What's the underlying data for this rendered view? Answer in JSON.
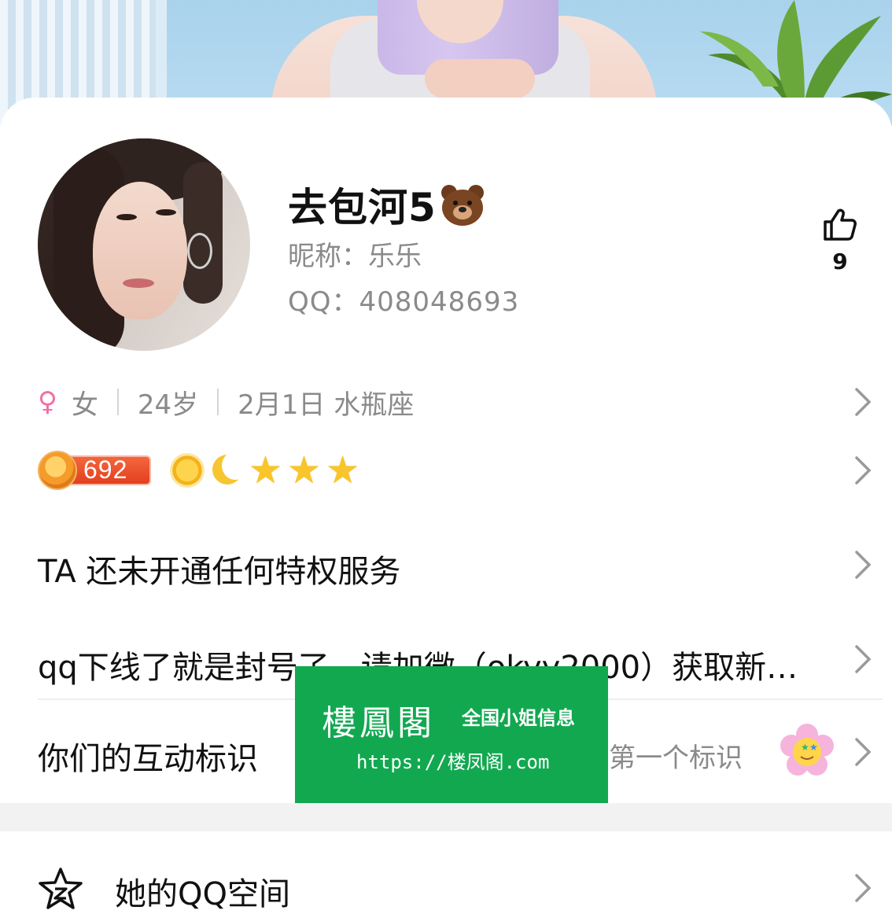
{
  "profile": {
    "remark_name": "去包河5",
    "nickname": "昵称：乐乐",
    "qq": "QQ：408048693",
    "like_count": "9"
  },
  "info": {
    "gender_symbol": "♀",
    "gender": "女",
    "age": "24岁",
    "birthday": "2月1日 水瓶座"
  },
  "level": {
    "value": "692",
    "stars": [
      "★",
      "★",
      "★"
    ]
  },
  "rows": {
    "privilege": "TA 还未开通任何特权服务",
    "signature": "qq下线了就是封号了，请加微（okyy2000）获取新…",
    "interaction": "你们的互动标识",
    "interaction_hint": "的第一个标识",
    "qzone": "她的QQ空间"
  },
  "watermark": {
    "title": "樓鳳閣",
    "subtitle": "全国小姐信息",
    "url": "https://楼凤阁.com"
  },
  "colors": {
    "female": "#f36fa6",
    "level_badge": "#e2401f",
    "watermark_bg": "#12a850"
  }
}
